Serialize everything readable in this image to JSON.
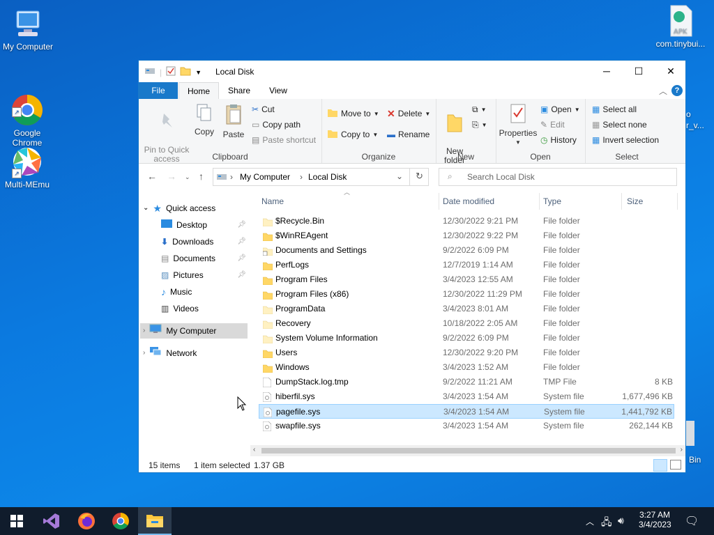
{
  "desktop": {
    "icons": [
      {
        "label": "My Computer"
      },
      {
        "label": "Google\nChrome"
      },
      {
        "label": "Multi-MEmu"
      },
      {
        "label": "com.tinybui..."
      },
      {
        "label": "APK"
      }
    ],
    "partial_labels": {
      "behind_1": "o",
      "behind_2": "r_v...",
      "recycle": "Bin"
    }
  },
  "window": {
    "title": "Local Disk",
    "controls": {
      "minimize": "─",
      "maximize": "☐",
      "close": "✕"
    }
  },
  "ribbon_tabs": [
    "File",
    "Home",
    "Share",
    "View"
  ],
  "ribbon": {
    "clipboard": {
      "label": "Clipboard",
      "pin": "Pin to Quick\naccess",
      "copy": "Copy",
      "paste": "Paste",
      "cut": "Cut",
      "copy_path": "Copy path",
      "paste_shortcut": "Paste shortcut"
    },
    "organize": {
      "label": "Organize",
      "move_to": "Move to",
      "copy_to": "Copy to",
      "delete": "Delete",
      "rename": "Rename"
    },
    "new": {
      "label": "New",
      "new_folder": "New\nfolder"
    },
    "open": {
      "label": "Open",
      "properties": "Properties",
      "open": "Open",
      "edit": "Edit",
      "history": "History"
    },
    "select": {
      "label": "Select",
      "select_all": "Select all",
      "select_none": "Select none",
      "invert": "Invert selection"
    }
  },
  "address": {
    "crumbs": [
      "My Computer",
      "Local Disk"
    ],
    "search_placeholder": "Search Local Disk"
  },
  "nav": {
    "quick_access": "Quick access",
    "items": [
      "Desktop",
      "Downloads",
      "Documents",
      "Pictures",
      "Music",
      "Videos"
    ],
    "my_computer": "My Computer",
    "network": "Network"
  },
  "columns": {
    "name": "Name",
    "date": "Date modified",
    "type": "Type",
    "size": "Size"
  },
  "files": [
    {
      "name": "$Recycle.Bin",
      "date": "12/30/2022 9:21 PM",
      "type": "File folder",
      "size": "",
      "kind": "folder-light"
    },
    {
      "name": "$WinREAgent",
      "date": "12/30/2022 9:22 PM",
      "type": "File folder",
      "size": "",
      "kind": "folder"
    },
    {
      "name": "Documents and Settings",
      "date": "9/2/2022 6:09 PM",
      "type": "File folder",
      "size": "",
      "kind": "link"
    },
    {
      "name": "PerfLogs",
      "date": "12/7/2019 1:14 AM",
      "type": "File folder",
      "size": "",
      "kind": "folder"
    },
    {
      "name": "Program Files",
      "date": "3/4/2023 12:55 AM",
      "type": "File folder",
      "size": "",
      "kind": "folder"
    },
    {
      "name": "Program Files (x86)",
      "date": "12/30/2022 11:29 PM",
      "type": "File folder",
      "size": "",
      "kind": "folder"
    },
    {
      "name": "ProgramData",
      "date": "3/4/2023 8:01 AM",
      "type": "File folder",
      "size": "",
      "kind": "folder-light"
    },
    {
      "name": "Recovery",
      "date": "10/18/2022 2:05 AM",
      "type": "File folder",
      "size": "",
      "kind": "folder-light"
    },
    {
      "name": "System Volume Information",
      "date": "9/2/2022 6:09 PM",
      "type": "File folder",
      "size": "",
      "kind": "folder-light"
    },
    {
      "name": "Users",
      "date": "12/30/2022 9:20 PM",
      "type": "File folder",
      "size": "",
      "kind": "folder"
    },
    {
      "name": "Windows",
      "date": "3/4/2023 1:52 AM",
      "type": "File folder",
      "size": "",
      "kind": "folder"
    },
    {
      "name": "DumpStack.log.tmp",
      "date": "9/2/2022 11:21 AM",
      "type": "TMP File",
      "size": "8 KB",
      "kind": "file"
    },
    {
      "name": "hiberfil.sys",
      "date": "3/4/2023 1:54 AM",
      "type": "System file",
      "size": "1,677,496 KB",
      "kind": "sys"
    },
    {
      "name": "pagefile.sys",
      "date": "3/4/2023 1:54 AM",
      "type": "System file",
      "size": "1,441,792 KB",
      "kind": "sys",
      "selected": true
    },
    {
      "name": "swapfile.sys",
      "date": "3/4/2023 1:54 AM",
      "type": "System file",
      "size": "262,144 KB",
      "kind": "sys"
    }
  ],
  "status": {
    "items": "15 items",
    "selected": "1 item selected",
    "size": "1.37 GB"
  },
  "taskbar": {
    "time": "3:27 AM",
    "date": "3/4/2023"
  }
}
